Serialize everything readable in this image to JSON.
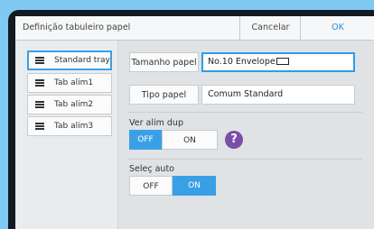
{
  "dialog": {
    "title": "Definição tabuleiro papel",
    "cancel_label": "Cancelar",
    "ok_label": "OK"
  },
  "trays": [
    {
      "label": "Standard tray",
      "selected": true
    },
    {
      "label": "Tab alim1",
      "selected": false
    },
    {
      "label": "Tab alim2",
      "selected": false
    },
    {
      "label": "Tab alim3",
      "selected": false
    }
  ],
  "paper_size": {
    "button_label": "Tamanho papel",
    "value": "No.10 Envelope"
  },
  "paper_type": {
    "button_label": "Tipo papel",
    "value": "Comum Standard"
  },
  "duplex_feed": {
    "label": "Ver alim dup",
    "off_label": "OFF",
    "on_label": "ON",
    "selected": "OFF",
    "help_glyph": "?"
  },
  "auto_select": {
    "label": "Seleç auto",
    "off_label": "OFF",
    "on_label": "ON",
    "selected": "ON"
  },
  "colors": {
    "accent": "#3aa0e6",
    "help": "#7b4ea8",
    "ok_text": "#2c8fd7"
  }
}
